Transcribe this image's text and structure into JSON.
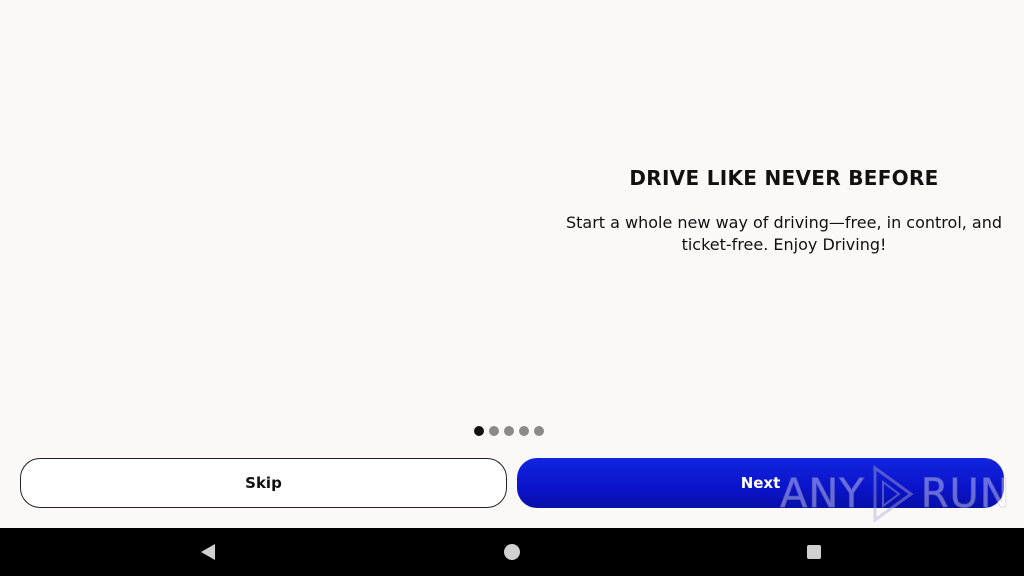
{
  "onboarding": {
    "title": "DRIVE LIKE NEVER BEFORE",
    "description": "Start a whole new way of driving—free, in control, and ticket-free. Enjoy Driving!",
    "page_indicator": {
      "total": 5,
      "current": 1
    }
  },
  "buttons": {
    "skip_label": "Skip",
    "next_label": "Next"
  },
  "watermark": {
    "text_left": "ANY",
    "text_right": "RUN"
  },
  "navbar": {
    "back_icon": "back-triangle-icon",
    "home_icon": "home-circle-icon",
    "recents_icon": "recents-square-icon"
  },
  "colors": {
    "background": "#fbf8f8",
    "primary": "#0a13c9",
    "text": "#111111",
    "dot_active": "#111111",
    "dot_inactive": "#8a8a8a"
  }
}
